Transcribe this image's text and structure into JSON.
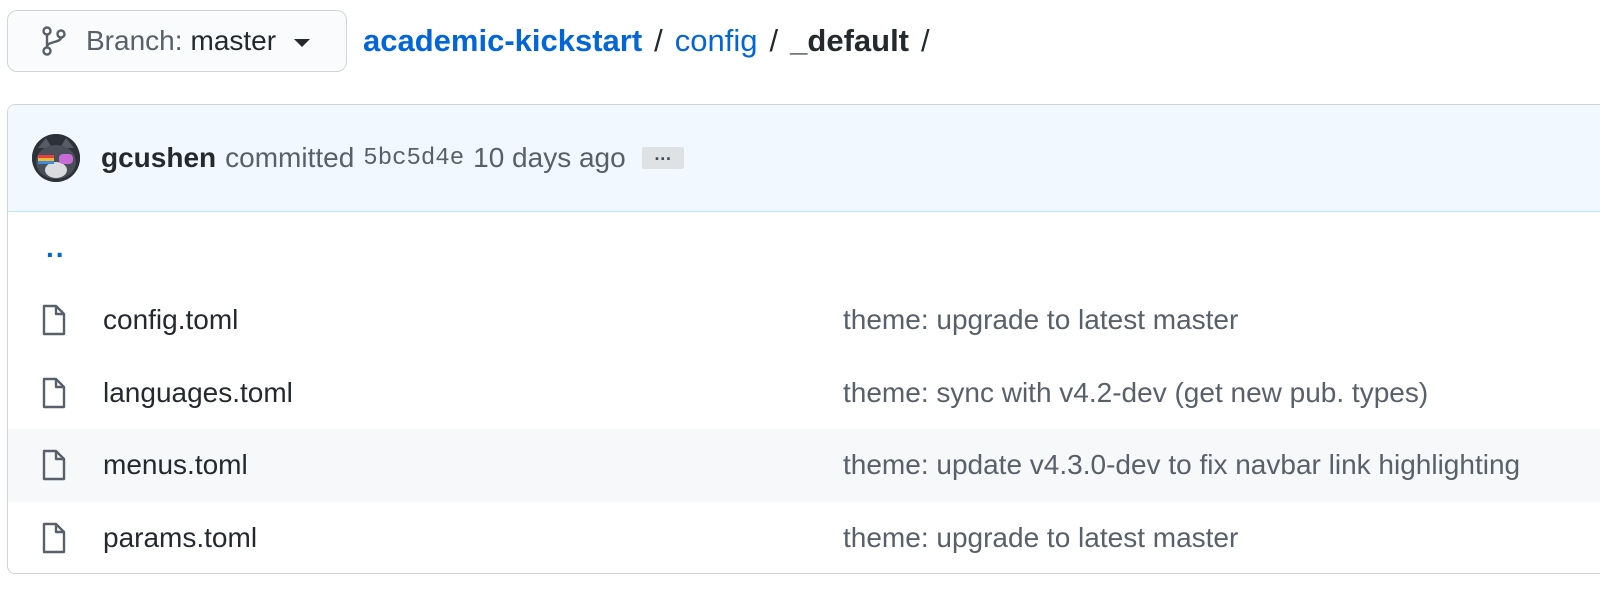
{
  "branch": {
    "label": "Branch:",
    "name": "master"
  },
  "breadcrumb": {
    "repo": "academic-kickstart",
    "folder": "config",
    "current": "_default",
    "separator": "/"
  },
  "commit": {
    "author": "gcushen",
    "action": "committed",
    "sha": "5bc5d4e",
    "time": "10 days ago",
    "more": "…"
  },
  "parent_link": "..",
  "files": [
    {
      "name": "config.toml",
      "message": "theme: upgrade to latest master",
      "icon": "file-icon"
    },
    {
      "name": "languages.toml",
      "message": "theme: sync with v4.2-dev (get new pub. types)",
      "icon": "file-icon"
    },
    {
      "name": "menus.toml",
      "message": "theme: update v4.3.0-dev to fix navbar link highlighting",
      "icon": "file-icon"
    },
    {
      "name": "params.toml",
      "message": "theme: upgrade to latest master",
      "icon": "file-icon"
    }
  ],
  "colors": {
    "link": "#0366d6",
    "commit_bg": "#f1f8ff",
    "hover_row": "#f6f8fa"
  }
}
